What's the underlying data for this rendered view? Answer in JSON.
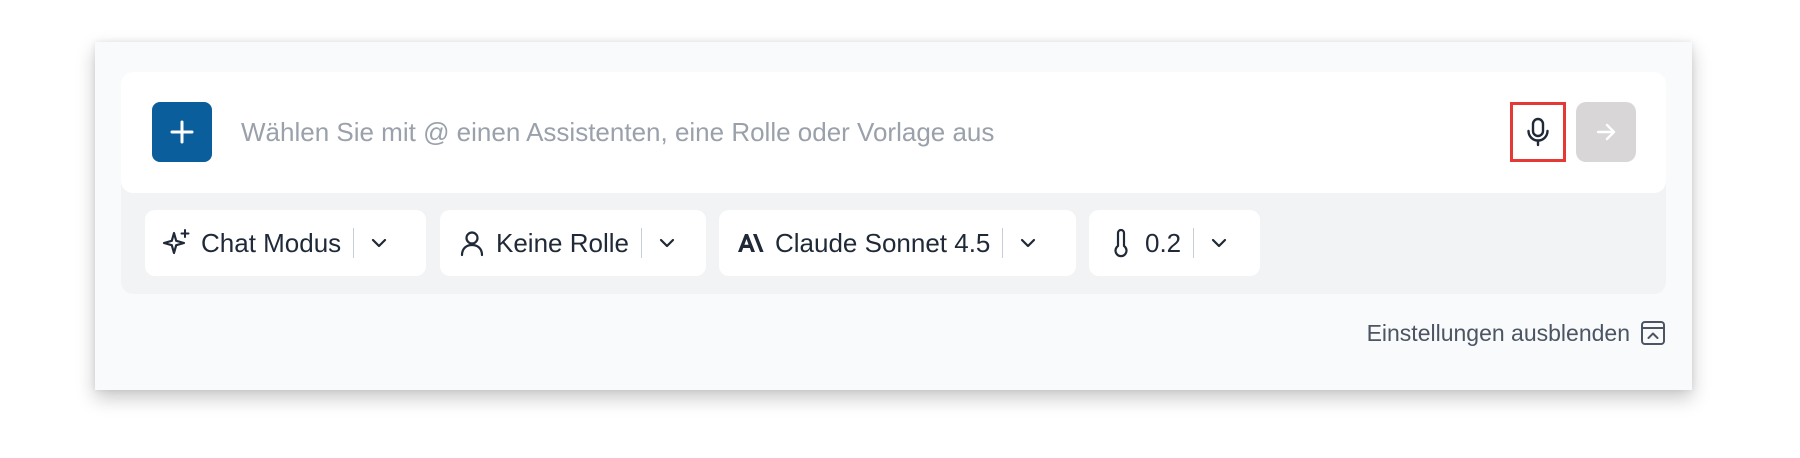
{
  "composer": {
    "add_icon": "plus-icon",
    "placeholder": "Wählen Sie mit @ einen Assistenten, eine Rolle oder Vorlage aus",
    "value": "",
    "mic_icon": "microphone-icon",
    "send_icon": "arrow-right-icon"
  },
  "settings": {
    "mode": {
      "icon": "sparkles-icon",
      "label": "Chat Modus"
    },
    "role": {
      "icon": "user-icon",
      "label": "Keine Rolle"
    },
    "model": {
      "icon": "anthropic-logo-icon",
      "label": "Claude Sonnet 4.5"
    },
    "temperature": {
      "icon": "thermometer-icon",
      "label": "0.2"
    },
    "toggle_label": "Einstellungen ausblenden",
    "toggle_icon": "collapse-panel-icon"
  },
  "colors": {
    "primary": "#0a5e9c",
    "highlight": "#e53935",
    "send_disabled": "#d8d6d6"
  }
}
